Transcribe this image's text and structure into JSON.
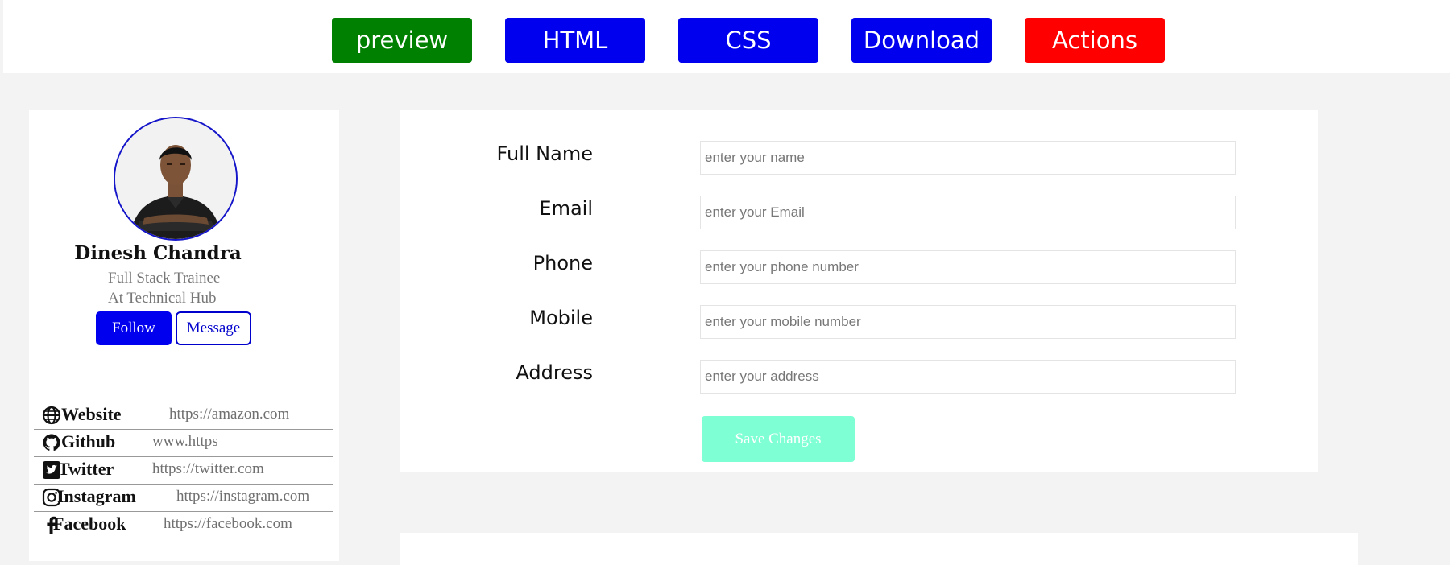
{
  "toolbar": {
    "buttons": [
      {
        "label": "preview",
        "color": "#008000"
      },
      {
        "label": "HTML",
        "color": "#0000ee"
      },
      {
        "label": "CSS",
        "color": "#0000ee"
      },
      {
        "label": "Download",
        "color": "#0000ee"
      },
      {
        "label": "Actions",
        "color": "#ff0000"
      }
    ]
  },
  "profile": {
    "name": "Dinesh Chandra",
    "role_line1": "Full Stack Trainee",
    "role_line2": "At Technical Hub",
    "follow_label": "Follow",
    "message_label": "Message",
    "links": [
      {
        "label": "Website",
        "url": "https://amazon.com",
        "icon": "globe-icon"
      },
      {
        "label": "Github",
        "url": "www.https",
        "icon": "github-icon"
      },
      {
        "label": "Twitter",
        "url": "https://twitter.com",
        "icon": "twitter-icon"
      },
      {
        "label": "Instagram",
        "url": "https://instagram.com",
        "icon": "instagram-icon"
      },
      {
        "label": "Facebook",
        "url": "https://facebook.com",
        "icon": "facebook-icon"
      }
    ]
  },
  "form": {
    "fields": [
      {
        "label": "Full Name",
        "placeholder": "enter your name",
        "value": ""
      },
      {
        "label": "Email",
        "placeholder": "enter your Email",
        "value": ""
      },
      {
        "label": "Phone",
        "placeholder": "enter your phone number",
        "value": ""
      },
      {
        "label": "Mobile",
        "placeholder": "enter your mobile number",
        "value": ""
      },
      {
        "label": "Address",
        "placeholder": "enter your address",
        "value": ""
      }
    ],
    "save_label": "Save Changes"
  },
  "colors": {
    "accent_blue": "#0000ee",
    "save_button": "#7fffd4",
    "avatar_border": "#1515c9"
  }
}
